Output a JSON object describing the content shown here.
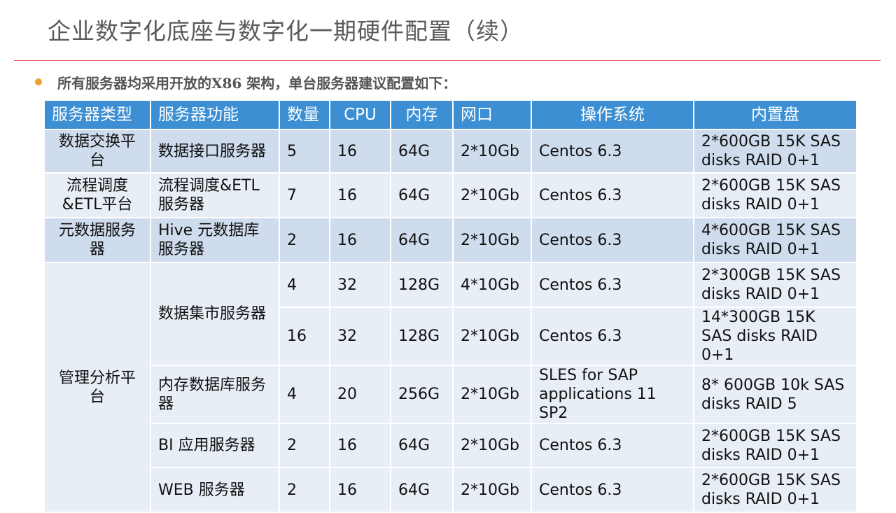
{
  "title": "企业数字化底座与数字化一期硬件配置（续）",
  "bullet": "所有服务器均采用开放的X86 架构，单台服务器建议配置如下：",
  "colors": {
    "header_bg": "#3b8fd2",
    "row_dark": "#cfdced",
    "row_light": "#e8eef6",
    "highlight_text": "#e0201c",
    "title_rule": "#e5605e",
    "bullet_dot": "#f0a030"
  },
  "table": {
    "headers": [
      "服务器类型",
      "服务器功能",
      "数量",
      "CPU",
      "内存",
      "网口",
      "操作系统",
      "内置盘"
    ],
    "rows": [
      {
        "type": "数据交换平台",
        "function": "数据接口服务器",
        "qty": "5",
        "cpu": "16",
        "mem": "64G",
        "net": "2*10Gb",
        "os": "Centos 6.3",
        "disk": "2*600GB 15K SAS disks RAID 0+1"
      },
      {
        "type": "流程调度&ETL平台",
        "function": "流程调度&ETL服务器",
        "qty": "7",
        "cpu": "16",
        "mem": "64G",
        "net": "2*10Gb",
        "os": "Centos 6.3",
        "disk": "2*600GB 15K SAS disks RAID 0+1"
      },
      {
        "type": "元数据服务器",
        "function": "Hive 元数据库服务器",
        "qty": "2",
        "cpu": "16",
        "mem": "64G",
        "net": "2*10Gb",
        "os": "Centos 6.3",
        "disk": "4*600GB 15K SAS disks RAID 0+1"
      }
    ],
    "group": {
      "type": "管理分析平台",
      "rows": [
        {
          "function": "数据集市服务器",
          "qty": "4",
          "cpu": "32",
          "mem": "128G",
          "net": "4*10Gb",
          "os": "Centos 6.3",
          "disk": "2*300GB 15K SAS disks RAID 0+1"
        },
        {
          "function": "",
          "qty": "16",
          "cpu": "32",
          "mem": "128G",
          "net": "2*10Gb",
          "os": "Centos 6.3",
          "disk": "14*300GB 15K SAS disks RAID 0+1"
        },
        {
          "function": "内存数据库服务器",
          "qty": "4",
          "cpu": "20",
          "mem": "256G",
          "net": "2*10Gb",
          "os": "SLES for SAP applications 11 SP2",
          "disk": "8* 600GB 10k SAS disks RAID 5"
        },
        {
          "function": "BI 应用服务器",
          "qty": "2",
          "cpu": "16",
          "mem": "64G",
          "net": "2*10Gb",
          "os": "Centos 6.3",
          "disk": "2*600GB 15K SAS disks RAID 0+1"
        },
        {
          "function": "WEB 服务器",
          "qty": "2",
          "cpu": "16",
          "mem": "64G",
          "net": "2*10Gb",
          "os": "Centos 6.3",
          "disk": "2*600GB 15K SAS disks RAID 0+1"
        }
      ]
    }
  }
}
